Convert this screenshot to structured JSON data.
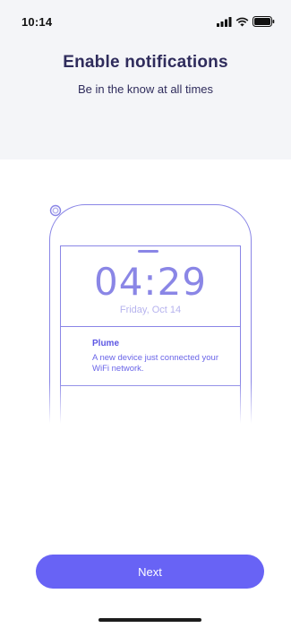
{
  "status_bar": {
    "time": "10:14",
    "icons": [
      "signal-icon",
      "wifi-icon",
      "battery-icon"
    ]
  },
  "header": {
    "title": "Enable notifications",
    "subtitle": "Be in the know at all times"
  },
  "phone_preview": {
    "time": "04:29",
    "date": "Friday, Oct 14",
    "notification": {
      "app_name": "Plume",
      "message": "A new device just connected your WiFi network.",
      "icon": "plume-logo-icon"
    }
  },
  "actions": {
    "next_label": "Next"
  },
  "colors": {
    "accent": "#6863f5",
    "header_background": "#f4f5f8",
    "title_text": "#2f2c5c",
    "phone_outline": "#8a86e6"
  }
}
